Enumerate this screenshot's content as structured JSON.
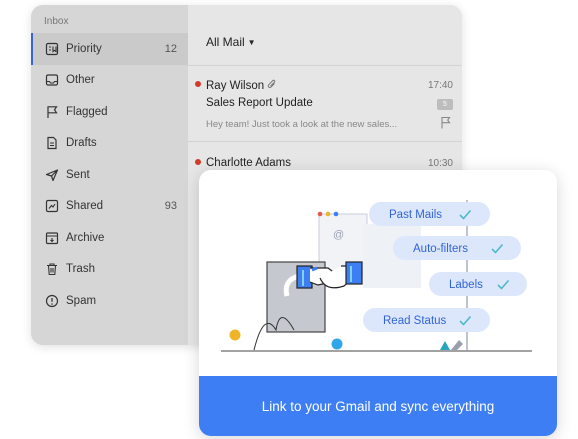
{
  "sidebar": {
    "header": "Inbox",
    "items": [
      {
        "label": "Priority",
        "count": "12",
        "icon": "priority-icon"
      },
      {
        "label": "Other",
        "count": "",
        "icon": "inbox-tray-icon"
      },
      {
        "label": "Flagged",
        "count": "",
        "icon": "flag-icon"
      },
      {
        "label": "Drafts",
        "count": "",
        "icon": "document-icon"
      },
      {
        "label": "Sent",
        "count": "",
        "icon": "paper-plane-icon"
      },
      {
        "label": "Shared",
        "count": "93",
        "icon": "shared-icon"
      },
      {
        "label": "Archive",
        "count": "",
        "icon": "archive-icon"
      },
      {
        "label": "Trash",
        "count": "",
        "icon": "trash-icon"
      },
      {
        "label": "Spam",
        "count": "",
        "icon": "alert-circle-icon"
      }
    ]
  },
  "mail_list": {
    "filter_label": "All Mail",
    "messages": [
      {
        "sender": "Ray Wilson",
        "time": "17:40",
        "subject": "Sales Report Update",
        "preview": "Hey team! Just took a look at the new sales...",
        "badge": "5",
        "unread": true
      },
      {
        "sender": "Charlotte Adams",
        "time": "10:30",
        "unread": true
      }
    ]
  },
  "promo": {
    "features": [
      "Past Mails",
      "Auto-filters",
      "Labels",
      "Read Status"
    ],
    "cta": "Link to your Gmail and sync everything"
  },
  "colors": {
    "accent": "#3d7ef5",
    "unread_dot": "#d23a2a",
    "pill_bg": "#dde7fb",
    "check": "#4fb8c8"
  }
}
